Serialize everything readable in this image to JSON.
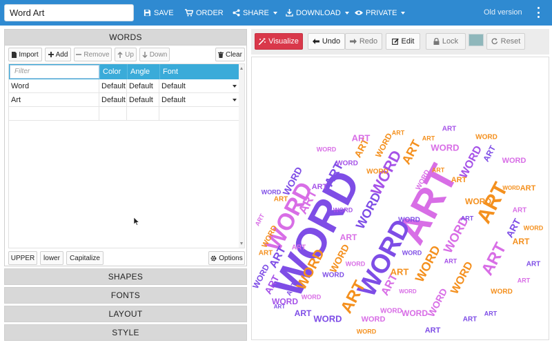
{
  "header": {
    "title_value": "Word Art",
    "nav": {
      "save": "SAVE",
      "order": "ORDER",
      "share": "SHARE",
      "download": "DOWNLOAD",
      "private": "PRIVATE"
    },
    "old_version": "Old version"
  },
  "words_panel": {
    "title": "WORDS",
    "buttons": {
      "import": "Import",
      "add": "Add",
      "remove": "Remove",
      "up": "Up",
      "down": "Down",
      "clear": "Clear"
    },
    "table": {
      "filter_placeholder": "Filter",
      "columns": [
        "Color",
        "Angle",
        "Font"
      ],
      "rows": [
        {
          "word": "Word",
          "color": "Default",
          "angle": "Default",
          "font": "Default"
        },
        {
          "word": "Art",
          "color": "Default",
          "angle": "Default",
          "font": "Default"
        }
      ]
    },
    "case_buttons": {
      "upper": "UPPER",
      "lower": "lower",
      "capitalize": "Capitalize"
    },
    "options": "Options"
  },
  "sections": {
    "shapes": "SHAPES",
    "fonts": "FONTS",
    "layout": "LAYOUT",
    "style": "STYLE"
  },
  "toolbar": {
    "visualize": "Visualize",
    "undo": "Undo",
    "redo": "Redo",
    "edit": "Edit",
    "lock": "Lock",
    "reset": "Reset",
    "swatch_color": "#8fb7bb"
  },
  "colors": {
    "header_blue": "#2f8ad1",
    "table_head": "#3aabd9",
    "visualize_red": "#d9384a",
    "purple": "#7e4de6",
    "pink": "#d86ee6",
    "orange": "#f4901e",
    "violet": "#a552e8"
  },
  "word_cloud": {
    "words": [
      {
        "text": "WORD",
        "color": "#7e4de6"
      },
      {
        "text": "ART",
        "color": "#d86ee6"
      },
      {
        "text": "WORD",
        "color": "#7e4de6"
      },
      {
        "text": "WORD",
        "color": "#d86ee6"
      },
      {
        "text": "ART",
        "color": "#f4901e"
      },
      {
        "text": "ART",
        "color": "#f4901e"
      },
      {
        "text": "WORD",
        "color": "#a552e8"
      },
      {
        "text": "ART",
        "color": "#d86ee6"
      },
      {
        "text": "WORD",
        "color": "#f4901e"
      },
      {
        "text": "ART",
        "color": "#7e4de6"
      },
      {
        "text": "WORD",
        "color": "#f4901e"
      },
      {
        "text": "ART",
        "color": "#d86ee6"
      },
      {
        "text": "WORD",
        "color": "#7e4de6"
      },
      {
        "text": "WORD",
        "color": "#d86ee6"
      },
      {
        "text": "ART",
        "color": "#f4901e"
      },
      {
        "text": "WORD",
        "color": "#a552e8"
      },
      {
        "text": "ART",
        "color": "#7e4de6"
      },
      {
        "text": "WORD",
        "color": "#f4901e"
      },
      {
        "text": "ART",
        "color": "#d86ee6"
      },
      {
        "text": "WORD",
        "color": "#7e4de6"
      },
      {
        "text": "ART",
        "color": "#f4901e"
      },
      {
        "text": "WORD",
        "color": "#d86ee6"
      },
      {
        "text": "ART",
        "color": "#7e4de6"
      },
      {
        "text": "WORD",
        "color": "#f4901e"
      },
      {
        "text": "ART",
        "color": "#a552e8"
      },
      {
        "text": "WORD",
        "color": "#d86ee6"
      },
      {
        "text": "ART",
        "color": "#f4901e"
      },
      {
        "text": "WORD",
        "color": "#7e4de6"
      },
      {
        "text": "ART",
        "color": "#d86ee6"
      },
      {
        "text": "WORD",
        "color": "#f4901e"
      },
      {
        "text": "ART",
        "color": "#7e4de6"
      },
      {
        "text": "WORD",
        "color": "#a552e8"
      },
      {
        "text": "ART",
        "color": "#f4901e"
      },
      {
        "text": "WORD",
        "color": "#d86ee6"
      },
      {
        "text": "ART",
        "color": "#7e4de6"
      },
      {
        "text": "WORD",
        "color": "#f4901e"
      },
      {
        "text": "ART",
        "color": "#d86ee6"
      },
      {
        "text": "WORD",
        "color": "#7e4de6"
      },
      {
        "text": "ART",
        "color": "#f4901e"
      },
      {
        "text": "WORD",
        "color": "#d86ee6"
      },
      {
        "text": "ART",
        "color": "#a552e8"
      },
      {
        "text": "WORD",
        "color": "#f4901e"
      },
      {
        "text": "ART",
        "color": "#7e4de6"
      },
      {
        "text": "WORD",
        "color": "#d86ee6"
      },
      {
        "text": "ART",
        "color": "#f4901e"
      },
      {
        "text": "WORD",
        "color": "#7e4de6"
      },
      {
        "text": "ART",
        "color": "#d86ee6"
      },
      {
        "text": "WORD",
        "color": "#f4901e"
      },
      {
        "text": "ART",
        "color": "#7e4de6"
      },
      {
        "text": "WORD",
        "color": "#a552e8"
      },
      {
        "text": "ART",
        "color": "#f4901e"
      },
      {
        "text": "WORD",
        "color": "#d86ee6"
      },
      {
        "text": "ART",
        "color": "#7e4de6"
      },
      {
        "text": "WORD",
        "color": "#f4901e"
      },
      {
        "text": "ART",
        "color": "#d86ee6"
      },
      {
        "text": "WORD",
        "color": "#7e4de6"
      },
      {
        "text": "ART",
        "color": "#f4901e"
      },
      {
        "text": "WORD",
        "color": "#d86ee6"
      },
      {
        "text": "ART",
        "color": "#a552e8"
      },
      {
        "text": "WORD",
        "color": "#f4901e"
      },
      {
        "text": "ART",
        "color": "#7e4de6"
      },
      {
        "text": "WORD",
        "color": "#d86ee6"
      },
      {
        "text": "ART",
        "color": "#f4901e"
      },
      {
        "text": "WORD",
        "color": "#7e4de6"
      },
      {
        "text": "ART",
        "color": "#d86ee6"
      },
      {
        "text": "WORD",
        "color": "#f4901e"
      },
      {
        "text": "ART",
        "color": "#7e4de6"
      },
      {
        "text": "WORD",
        "color": "#a552e8"
      },
      {
        "text": "ART",
        "color": "#f4901e"
      },
      {
        "text": "WORD",
        "color": "#d86ee6"
      },
      {
        "text": "ART",
        "color": "#7e4de6"
      },
      {
        "text": "WORD",
        "color": "#f4901e"
      },
      {
        "text": "ART",
        "color": "#d86ee6"
      },
      {
        "text": "WORD",
        "color": "#7e4de6"
      },
      {
        "text": "ART",
        "color": "#f4901e"
      },
      {
        "text": "WORD",
        "color": "#d86ee6"
      },
      {
        "text": "ART",
        "color": "#a552e8"
      },
      {
        "text": "WORD",
        "color": "#f4901e"
      },
      {
        "text": "ART",
        "color": "#7e4de6"
      },
      {
        "text": "WORD",
        "color": "#d86ee6"
      }
    ]
  }
}
